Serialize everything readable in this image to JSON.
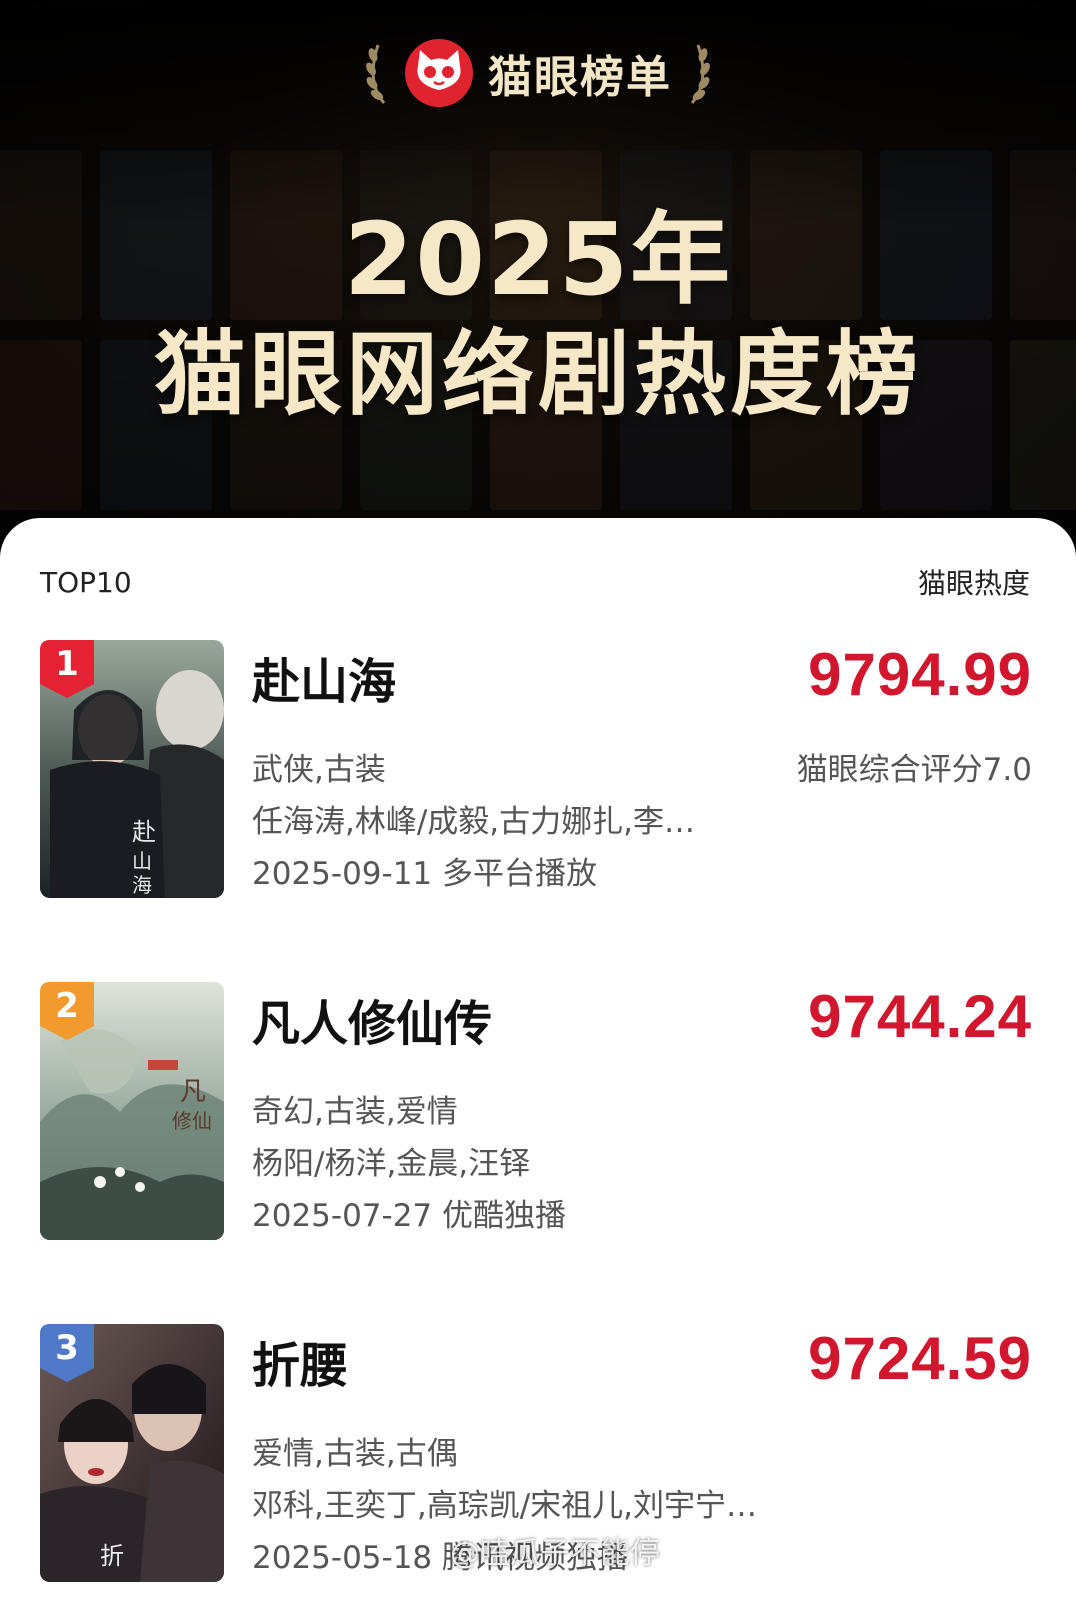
{
  "brand": {
    "name": "猫眼榜单",
    "logo_icon": "cat-face-logo",
    "laurel_icon": "laurel-icon"
  },
  "hero": {
    "year_title": "2025年",
    "main_title": "猫眼网络剧热度榜"
  },
  "list_header": {
    "left": "TOP10",
    "right": "猫眼热度"
  },
  "items": [
    {
      "rank": "1",
      "title": "赴山海",
      "score": "9794.99",
      "rating": "猫眼综合评分7.0",
      "genres": "武侠,古装",
      "cast": "任海涛,林峰/成毅,古力娜扎,李…",
      "release": "2025-09-11 多平台播放",
      "badge_color": "#e52233"
    },
    {
      "rank": "2",
      "title": "凡人修仙传",
      "score": "9744.24",
      "rating": "",
      "genres": "奇幻,古装,爱情",
      "cast": "杨阳/杨洋,金晨,汪铎",
      "release": "2025-07-27 优酷独播",
      "badge_color": "#f29a2e"
    },
    {
      "rank": "3",
      "title": "折腰",
      "score": "9724.59",
      "rating": "",
      "genres": "爱情,古装,古偶",
      "cast": "邓科,王奕丁,高琮凯/宋祖儿,刘宇宁…",
      "release": "2025-05-18 腾讯视频独播",
      "badge_color": "#4f78c9"
    }
  ],
  "watermark": "@嗑瓜子不能停",
  "colors": {
    "score_red": "#d2162d",
    "title_gold": "#f6e8c6",
    "panel_bg": "#ffffff"
  }
}
